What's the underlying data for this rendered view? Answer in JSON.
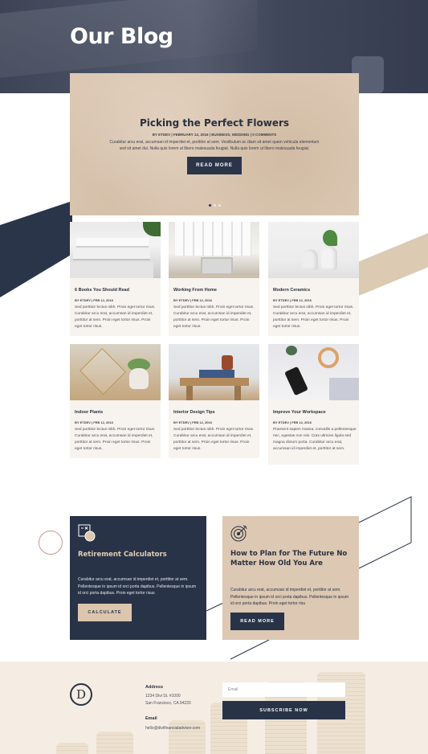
{
  "hero": {
    "title": "Our Blog"
  },
  "featured": {
    "title": "Picking the Perfect Flowers",
    "meta": "BY ETDEV | FEBRUARY 12, 2016 | BUSINESS, WEDDING | 0 COMMENTS",
    "excerpt": "Curabitur arcu erat, accumsan id imperdiet et, porttitor at sem. Vestibulum ac diam sit amet quam vehicula elementum sed sit amet dui. Nulla quis lorem ut libero malesuada feugiat. Nulla quis lorem ut libero malesuada feugiat.",
    "button": "READ MORE",
    "slide_count": 3,
    "active_slide": 1
  },
  "posts": [
    {
      "title": "6 Books You Should Read",
      "meta": "BY ETDEV | FEB 12, 2016",
      "excerpt": "Sed porttitor lectus nibh. Proin eget tortor risus. Curabitur arcu erat, accumsan id imperdiet et, porttitor at sem. Proin eget tortor risus. Proin eget tortor risus.",
      "image": "books-stack"
    },
    {
      "title": "Working From Home",
      "meta": "BY ETDEV | FEB 12, 2016",
      "excerpt": "Sed porttitor lectus nibh. Proin eget tortor risus. Curabitur arcu erat, accumsan id imperdiet et, porttitor at sem. Proin eget tortor risus. Proin eget tortor risus.",
      "image": "home-desk"
    },
    {
      "title": "Modern Ceramics",
      "meta": "BY ETDEV | FEB 12, 2016",
      "excerpt": "Sed porttitor lectus nibh. Proin eget tortor risus. Curabitur arcu erat, accumsan id imperdiet et, porttitor at sem. Proin eget tortor risus. Proin eget tortor risus.",
      "image": "ceramic-vases"
    },
    {
      "title": "Indoor Plants",
      "meta": "BY ETDEV | FEB 12, 2016",
      "excerpt": "Sed porttitor lectus nibh. Proin eget tortor risus. Curabitur arcu erat, accumsan id imperdiet et, porttitor at sem. Proin eget tortor risus. Proin eget tortor risus.",
      "image": "terrarium-plants"
    },
    {
      "title": "Interior Design Tips",
      "meta": "BY ETDEV | FEB 12, 2016",
      "excerpt": "Sed porttitor lectus nibh. Proin eget tortor risus. Curabitur arcu erat, accumsan id imperdiet et, porttitor at sem. Proin eget tortor risus. Proin eget tortor risus.",
      "image": "stool-decor"
    },
    {
      "title": "Improve Your Workspace",
      "meta": "BY ETDEV | FEB 12, 2016",
      "excerpt": "Praesent sapien massa, convallis a pellentesque nec, egestas non nisi. Cras ultricies ligula sed magna dictum porta. Curabitur arcu erat, accumsan id imperdiet et, porttitor at sem.",
      "image": "workspace-headphones"
    }
  ],
  "services": [
    {
      "title": "Retirement Calculators",
      "desc": "Curabitur arcu erat, accumsan id imperdiet et, porttitor at sem. Pellentesque in ipsum id orci porta dapibus. Pellentesque in ipsum id orci porta dapibus. Proin eget tortor risus",
      "button": "CALCULATE",
      "icon": "calculator-icon"
    },
    {
      "title": "How to Plan for The Future No Matter How Old You Are",
      "desc": "Curabitur arcu erat, accumsan id imperdiet et, porttitor at sem. Pellentesque in ipsum id orci porta dapibus. Pellentesque in ipsum id orci porta dapibus. Proin eget tortor risu",
      "button": "READ MORE",
      "icon": "target-icon"
    }
  ],
  "footer": {
    "logo_letter": "D",
    "address_heading": "Address",
    "address_line1": "1234 Divi St. #1000",
    "address_line2": "San Francisco, CA 94220",
    "email_heading": "Email",
    "email": "hello@divifinancialadvisor.com",
    "email_placeholder": "Email",
    "subscribe": "SUBSCRIBE NOW"
  },
  "colors": {
    "navy": "#283348",
    "tan": "#dcc8b3",
    "cream": "#f5ede3",
    "card_bg": "#f7f3ee"
  }
}
